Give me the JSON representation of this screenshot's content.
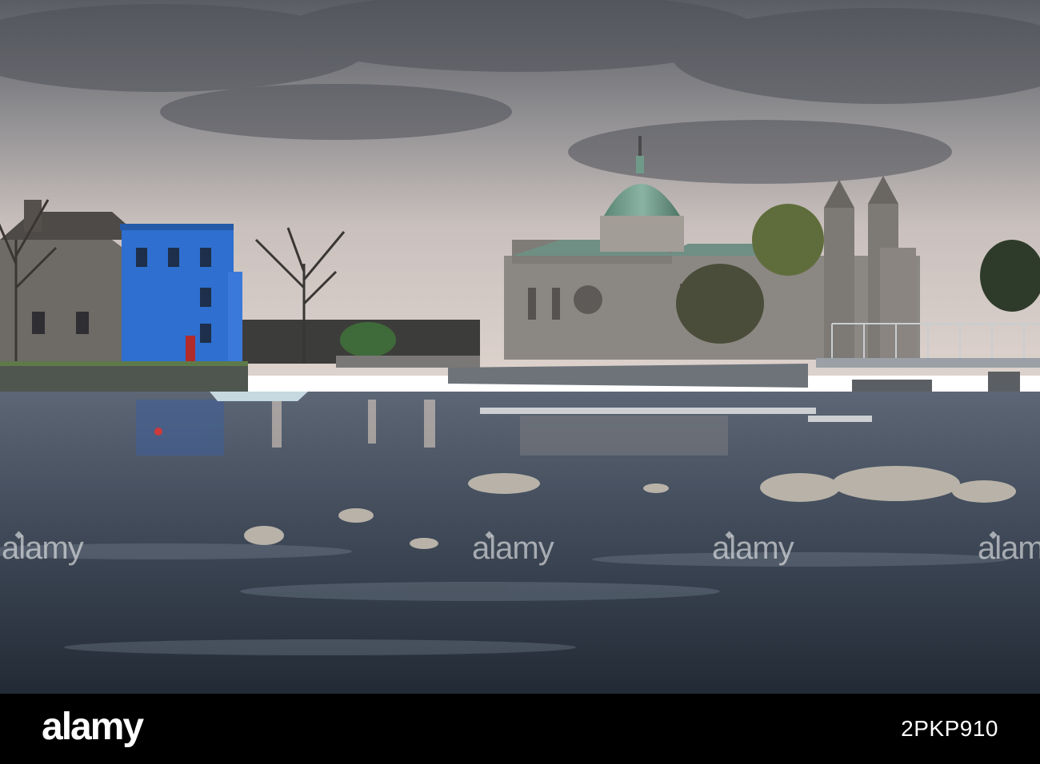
{
  "watermark": {
    "text": "alamy"
  },
  "footer": {
    "brand": "alamy",
    "image_id": "2PKP910",
    "background_color": "#000000"
  },
  "scene": {
    "sky_color": "#6f7075",
    "water_color": "#3a4452",
    "dome_color": "#6f9a8a",
    "blue_house_color": "#2f6fcf"
  }
}
